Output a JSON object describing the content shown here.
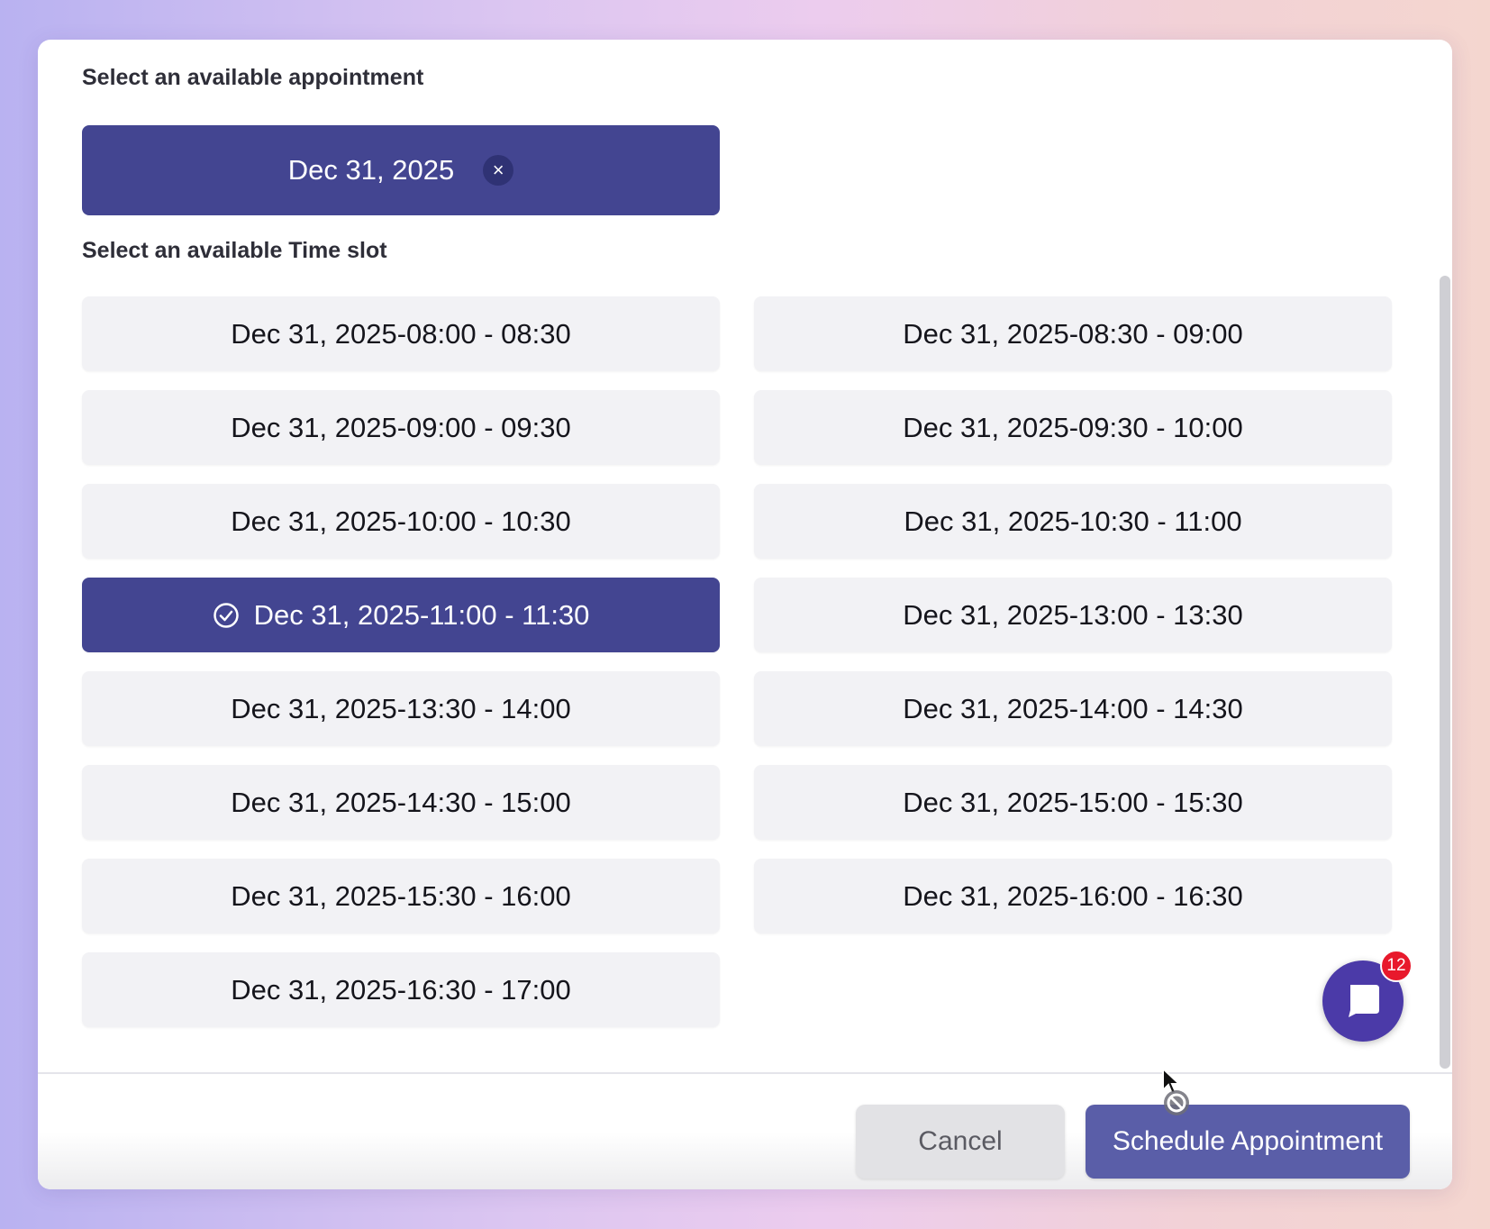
{
  "appointment": {
    "label": "Select an available appointment",
    "date": "Dec 31, 2025",
    "clear_icon": "close-icon"
  },
  "timeslots": {
    "label": "Select an available Time slot",
    "selected_index": 6,
    "items": [
      "Dec 31, 2025-08:00 - 08:30",
      "Dec 31, 2025-08:30 - 09:00",
      "Dec 31, 2025-09:00 - 09:30",
      "Dec 31, 2025-09:30 - 10:00",
      "Dec 31, 2025-10:00 - 10:30",
      "Dec 31, 2025-10:30 - 11:00",
      "Dec 31, 2025-11:00 - 11:30",
      "Dec 31, 2025-13:00 - 13:30",
      "Dec 31, 2025-13:30 - 14:00",
      "Dec 31, 2025-14:00 - 14:30",
      "Dec 31, 2025-14:30 - 15:00",
      "Dec 31, 2025-15:00 - 15:30",
      "Dec 31, 2025-15:30 - 16:00",
      "Dec 31, 2025-16:00 - 16:30",
      "Dec 31, 2025-16:30 - 17:00"
    ]
  },
  "footer": {
    "cancel_label": "Cancel",
    "schedule_label": "Schedule Appointment"
  },
  "chat": {
    "badge_count": "12",
    "icon": "chat-bubble-icon"
  },
  "colors": {
    "accent": "#434591",
    "slot_bg": "#f2f2f5",
    "badge": "#e8192c"
  }
}
